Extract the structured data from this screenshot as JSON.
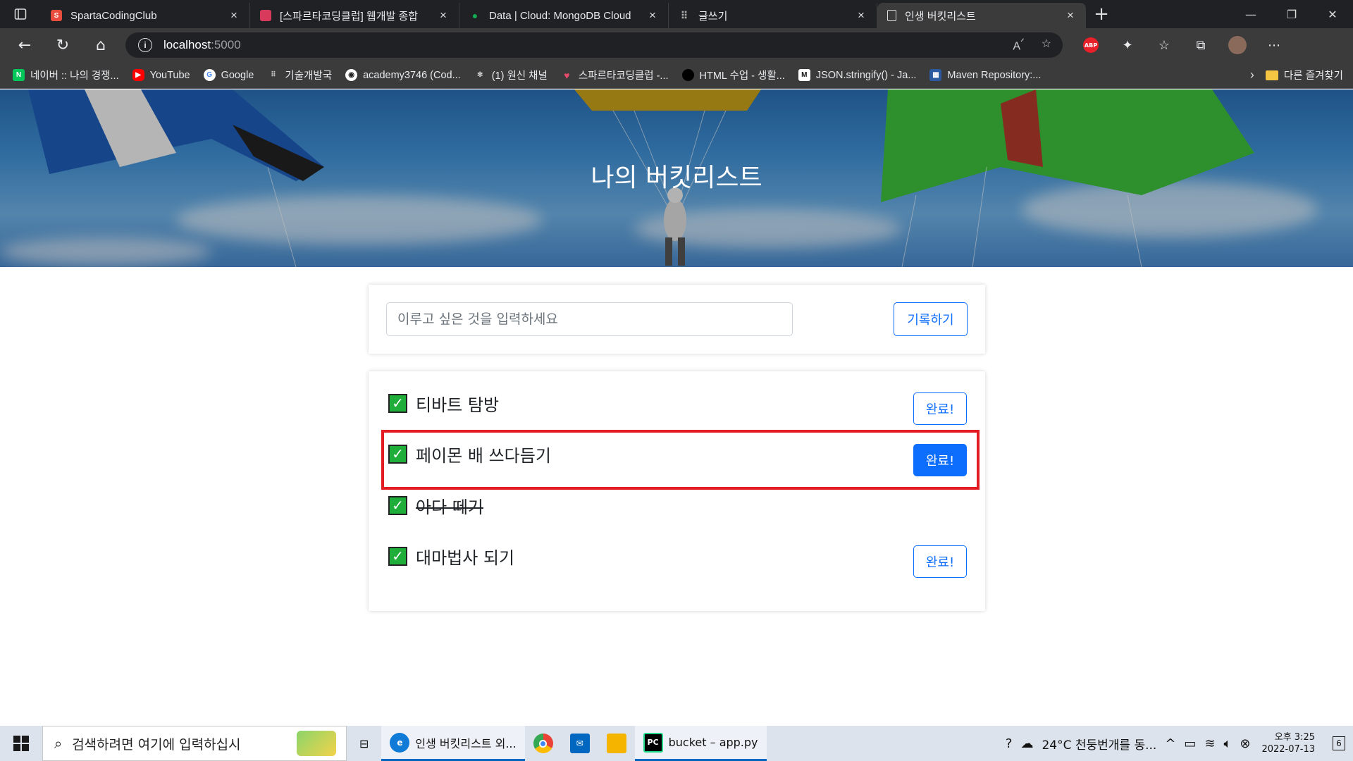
{
  "browser": {
    "tabs": [
      {
        "label": "SpartaCodingClub",
        "color": "#e74c3c",
        "glyph": "S"
      },
      {
        "label": "[스파르타코딩클럽] 웹개발 종합",
        "color": "#d83a5c",
        "glyph": "▮"
      },
      {
        "label": "Data | Cloud: MongoDB Cloud",
        "color": "#13aa52",
        "glyph": "●"
      },
      {
        "label": "글쓰기",
        "color": "#555555",
        "glyph": "⠿"
      },
      {
        "label": "인생 버킷리스트",
        "color": "#3b3b3b",
        "glyph": "▯"
      }
    ],
    "url_host": "localhost",
    "url_port": ":5000",
    "bookmarks": [
      {
        "label": "네이버 :: 나의 경쟁...",
        "color": "#03c75a",
        "glyph": "N"
      },
      {
        "label": "YouTube",
        "color": "#ff0000",
        "glyph": "▶"
      },
      {
        "label": "Google",
        "color": "#4285f4",
        "glyph": "G"
      },
      {
        "label": "기술개발국",
        "color": "#555555",
        "glyph": "⠿"
      },
      {
        "label": "academy3746 (Cod...",
        "color": "#222222",
        "glyph": "◉"
      },
      {
        "label": "(1) 원신 채널",
        "color": "#666666",
        "glyph": "✻"
      },
      {
        "label": "스파르타코딩클럽 -...",
        "color": "#e84a6a",
        "glyph": "♥"
      },
      {
        "label": "HTML 수업 - 생활...",
        "color": "#111111",
        "glyph": "●"
      },
      {
        "label": "JSON.stringify() - Ja...",
        "color": "#222222",
        "glyph": "M"
      },
      {
        "label": "Maven Repository:...",
        "color": "#2c5aa0",
        "glyph": "▦"
      }
    ],
    "other_bookmarks": "다른 즐겨찾기"
  },
  "page": {
    "title": "나의 버킷리스트",
    "input_placeholder": "이루고 싶은 것을 입력하세요",
    "save_label": "기록하기",
    "items": [
      {
        "text": "티바트 탐방",
        "done": false,
        "button": "완료!"
      },
      {
        "text": "페이몬 배 쓰다듬기",
        "done": false,
        "button": "완료!"
      },
      {
        "text": "아다 떼기",
        "done": true,
        "button": ""
      },
      {
        "text": "대마법사 되기",
        "done": false,
        "button": "완료!"
      }
    ]
  },
  "taskbar": {
    "search_placeholder": "검색하려면 여기에 입력하십시",
    "apps": [
      {
        "label": "인생 버킷리스트 외...",
        "color": "#0f7bd6",
        "glyph": "e"
      },
      {
        "label": "",
        "color": "#ea4335",
        "glyph": "◉"
      },
      {
        "label": "",
        "color": "#0067c0",
        "glyph": "✉"
      },
      {
        "label": "",
        "color": "#f4b400",
        "glyph": "▤"
      },
      {
        "label": "bucket – app.py",
        "color": "#21d789",
        "glyph": "PC"
      }
    ],
    "weather": "24°C  천둥번개를 동...",
    "time": "오후 3:25",
    "date": "2022-07-13",
    "notifications": "6"
  }
}
